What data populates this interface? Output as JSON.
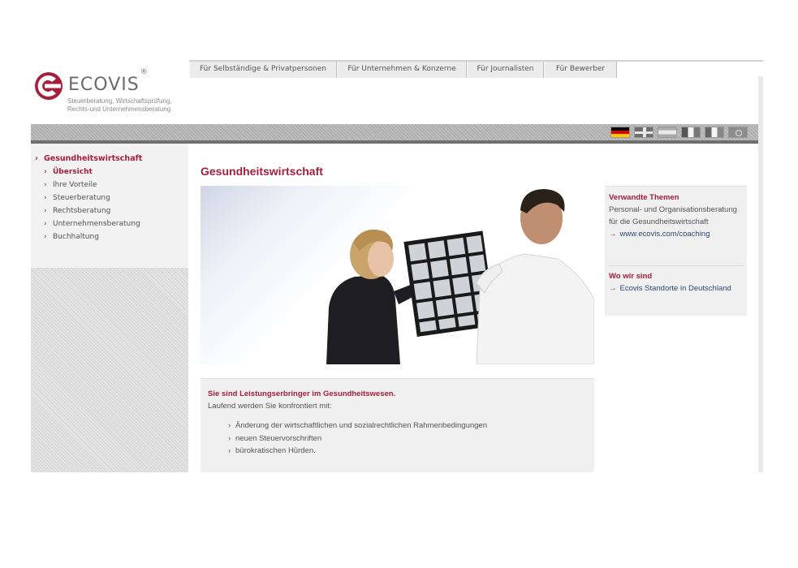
{
  "logo": {
    "name": "ECOVIS",
    "registered": "®",
    "tagline_line1": "Steuerberatung, Wirtschaftsprüfung,",
    "tagline_line2": "Rechts-und Unternehmensberatung",
    "brand_color": "#a71e3b"
  },
  "topnav": {
    "tabs": [
      {
        "label": "Für Selbständige & Privatpersonen"
      },
      {
        "label": "Für Unternehmen & Konzerne"
      },
      {
        "label": "Für Journalisten"
      },
      {
        "label": "Für Bewerber"
      }
    ]
  },
  "languages": [
    "german-flag-icon",
    "uk-flag-icon",
    "spanish-flag-icon",
    "french-flag-icon",
    "italian-flag-icon",
    "japanese-flag-icon"
  ],
  "sidebar": {
    "section": "Gesundheitswirtschaft",
    "items": [
      {
        "label": "Übersicht",
        "active": true
      },
      {
        "label": "Ihre Vorteile"
      },
      {
        "label": "Steuerberatung"
      },
      {
        "label": "Rechtsberatung"
      },
      {
        "label": "Unternehmensberatung"
      },
      {
        "label": "Buchhaltung"
      }
    ]
  },
  "main": {
    "title": "Gesundheitswirtschaft",
    "hero_alt": "Zwei Personen betrachten Röntgenbilder",
    "info": {
      "heading": "Sie sind Leistungserbringer im Gesundheitswesen.",
      "intro": "Laufend werden Sie konfrontiert mit:",
      "bullets": [
        "Änderung der wirtschaftlichen und sozialrechtlichen Rahmenbedingungen",
        "neuen Steuervorschriften",
        "bürokratischen Hürden."
      ]
    }
  },
  "related": {
    "heading1": "Verwandte Themen",
    "text1": "Personal- und Organisationsberatung für die Gesundheitswirtschaft",
    "link1": "www.ecovis.com/coaching",
    "heading2": "Wo wir sind",
    "link2": "Ecovis Standorte in Deutschland"
  }
}
